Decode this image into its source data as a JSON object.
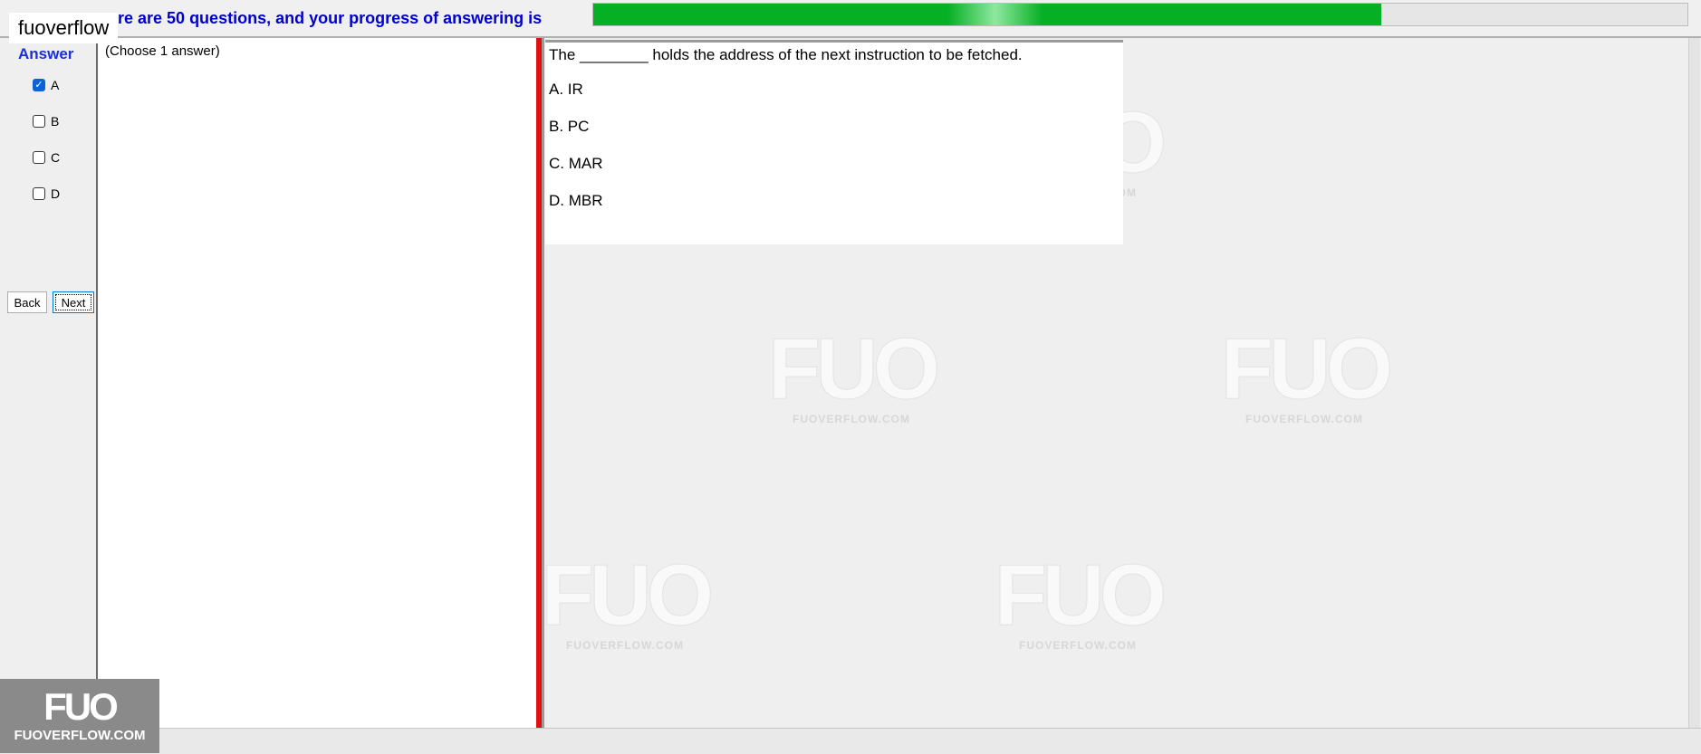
{
  "header": {
    "site_label": "fuoverflow",
    "banner_text": "re are 50 questions, and your progress of answering is",
    "progress_fraction": 0.72,
    "progress_color": "#06b025"
  },
  "answer_panel": {
    "heading": "Answer",
    "options": [
      {
        "label": "A",
        "checked": true
      },
      {
        "label": "B",
        "checked": false
      },
      {
        "label": "C",
        "checked": false
      },
      {
        "label": "D",
        "checked": false
      }
    ],
    "back_label": "Back",
    "next_label": "Next"
  },
  "instruction": "(Choose 1 answer)",
  "question": {
    "text": "The ________ holds the address of the next instruction to be fetched.",
    "options": [
      "A.  IR",
      "B.  PC",
      "C.  MAR",
      "D.  MBR"
    ]
  },
  "watermark": {
    "logo_text": "FUO",
    "url_text": "FUOVERFLOW.COM"
  },
  "corner_logo": {
    "logo_text": "FUO",
    "url_text": "FUOVERFLOW.COM"
  },
  "colors": {
    "question_heading": "#1b2fd6",
    "banner_text": "#0000cc",
    "divider_red": "#e01010",
    "checked_box": "#0a64d8"
  }
}
